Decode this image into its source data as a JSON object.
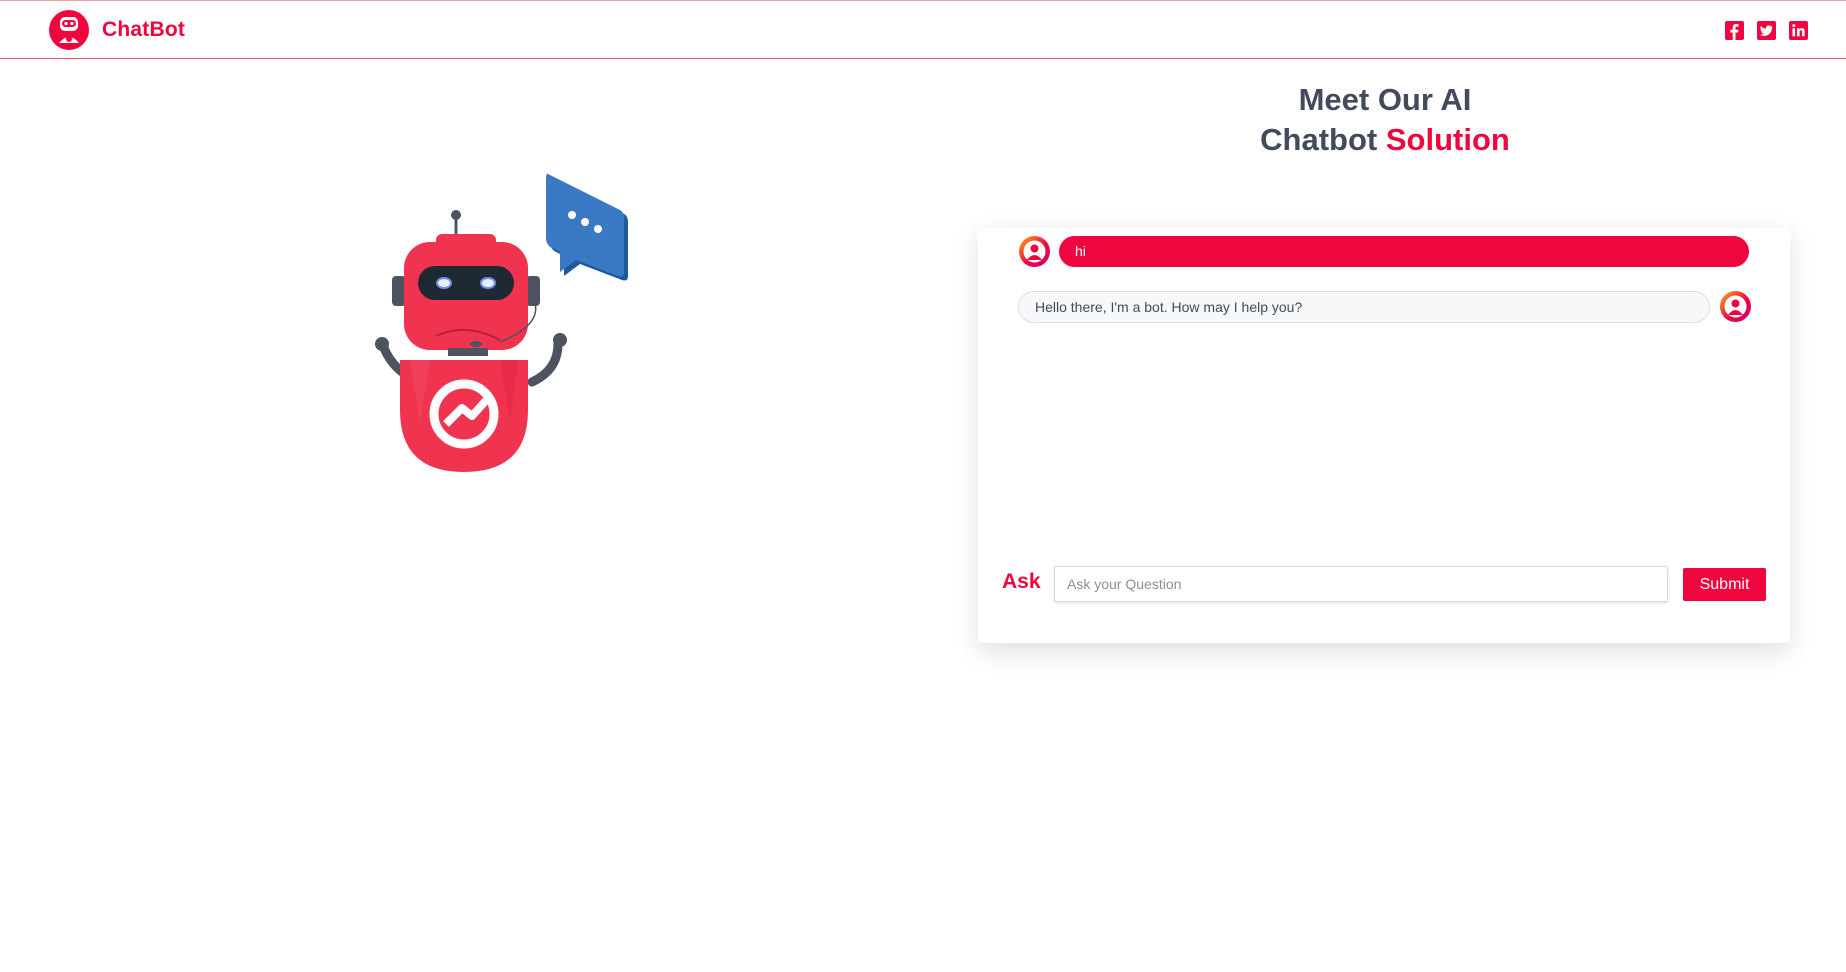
{
  "header": {
    "brand_name": "ChatBot",
    "social": [
      {
        "name": "facebook-icon",
        "glyph": "f"
      },
      {
        "name": "twitter-icon",
        "glyph": "t"
      },
      {
        "name": "linkedin-icon",
        "glyph": "in"
      }
    ]
  },
  "hero": {
    "line1": "Meet Our AI",
    "line2_plain": "Chatbot",
    "line2_accent": "Solution"
  },
  "chat": {
    "messages": [
      {
        "from": "user",
        "text": "hi"
      },
      {
        "from": "bot",
        "text": "Hello there, I'm a bot. How may I help you?"
      }
    ],
    "ask_label": "Ask",
    "input_value": "",
    "input_placeholder": "Ask your Question",
    "submit_label": "Submit"
  },
  "colors": {
    "accent": "#f0063f",
    "heading": "#424a5c",
    "robot_blue": "#3a7ac4"
  }
}
